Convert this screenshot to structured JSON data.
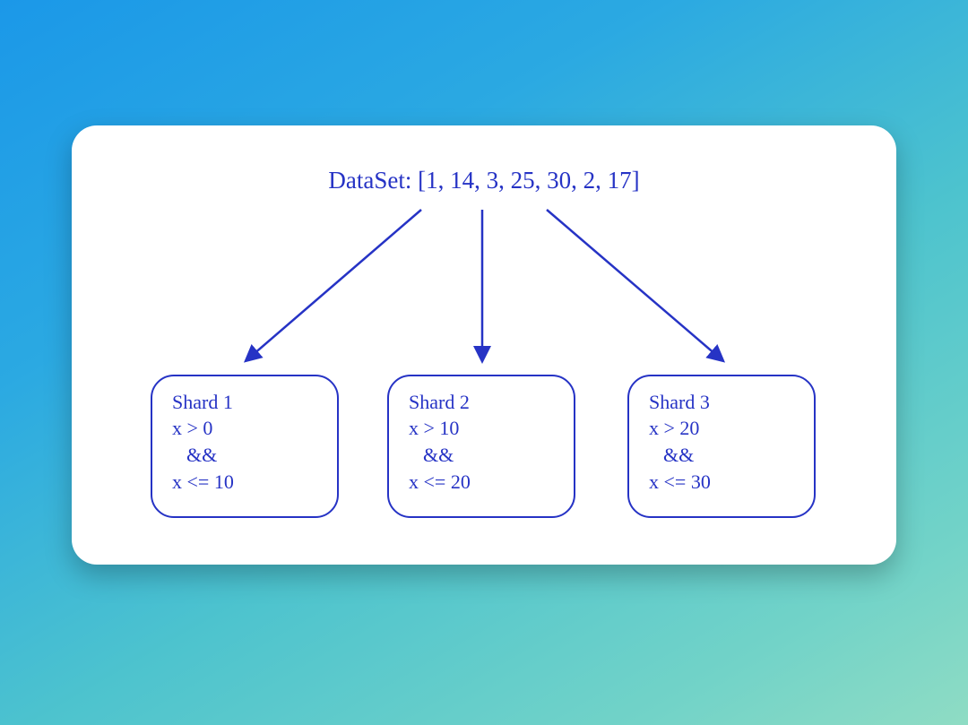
{
  "colors": {
    "ink": "#2633c5"
  },
  "dataset_label": "DataSet: [1, 14, 3, 25, 30, 2, 17]",
  "shards": [
    {
      "title": "Shard 1",
      "cond1": "x > 0",
      "op": "&&",
      "cond2": "x <= 10"
    },
    {
      "title": "Shard 2",
      "cond1": "x > 10",
      "op": "&&",
      "cond2": "x <= 20"
    },
    {
      "title": "Shard 3",
      "cond1": "x > 20",
      "op": "&&",
      "cond2": "x <= 30"
    }
  ]
}
